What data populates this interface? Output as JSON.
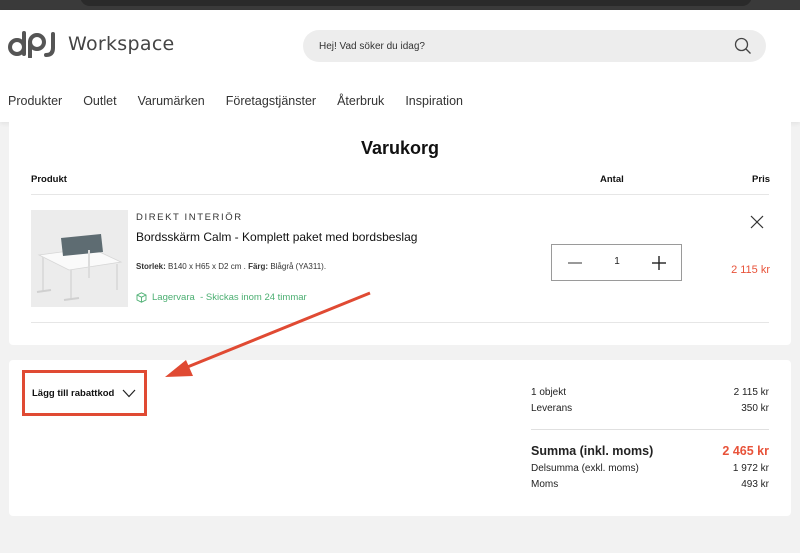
{
  "brand": {
    "logo_text": "Workspace"
  },
  "search": {
    "placeholder": "Hej! Vad söker du idag?"
  },
  "nav": {
    "items": [
      "Produkter",
      "Outlet",
      "Varumärken",
      "Företagstjänster",
      "Återbruk",
      "Inspiration"
    ]
  },
  "cart": {
    "title": "Varukorg",
    "headers": {
      "product": "Produkt",
      "quantity": "Antal",
      "price": "Pris"
    },
    "item": {
      "brand": "DIREKT INTERIÖR",
      "name": "Bordsskärm Calm - Komplett paket med bordsbeslag",
      "size_label": "Storlek:",
      "size_value": "B140 x H65 x D2 cm",
      "color_label": "Färg:",
      "color_value": "Blågrå (YA311).",
      "stock": "Lagervara",
      "shipping": "- Skickas inom 24 timmar",
      "quantity": "1",
      "price": "2 115 kr"
    }
  },
  "summary": {
    "discount_label": "Lägg till rabattkod",
    "items_label": "1 objekt",
    "items_value": "2 115 kr",
    "delivery_label": "Leverans",
    "delivery_value": "350 kr",
    "total_label": "Summa (inkl. moms)",
    "total_value": "2 465 kr",
    "subtotal_label": "Delsumma (exkl. moms)",
    "subtotal_value": "1 972 kr",
    "vat_label": "Moms",
    "vat_value": "493 kr"
  },
  "colors": {
    "accent": "#e8533a",
    "stock_green": "#4caf72",
    "annotation_red": "#e04a33"
  },
  "icons": [
    "search-icon",
    "close-icon",
    "minus-icon",
    "plus-icon",
    "chevron-down-icon",
    "box-icon"
  ]
}
